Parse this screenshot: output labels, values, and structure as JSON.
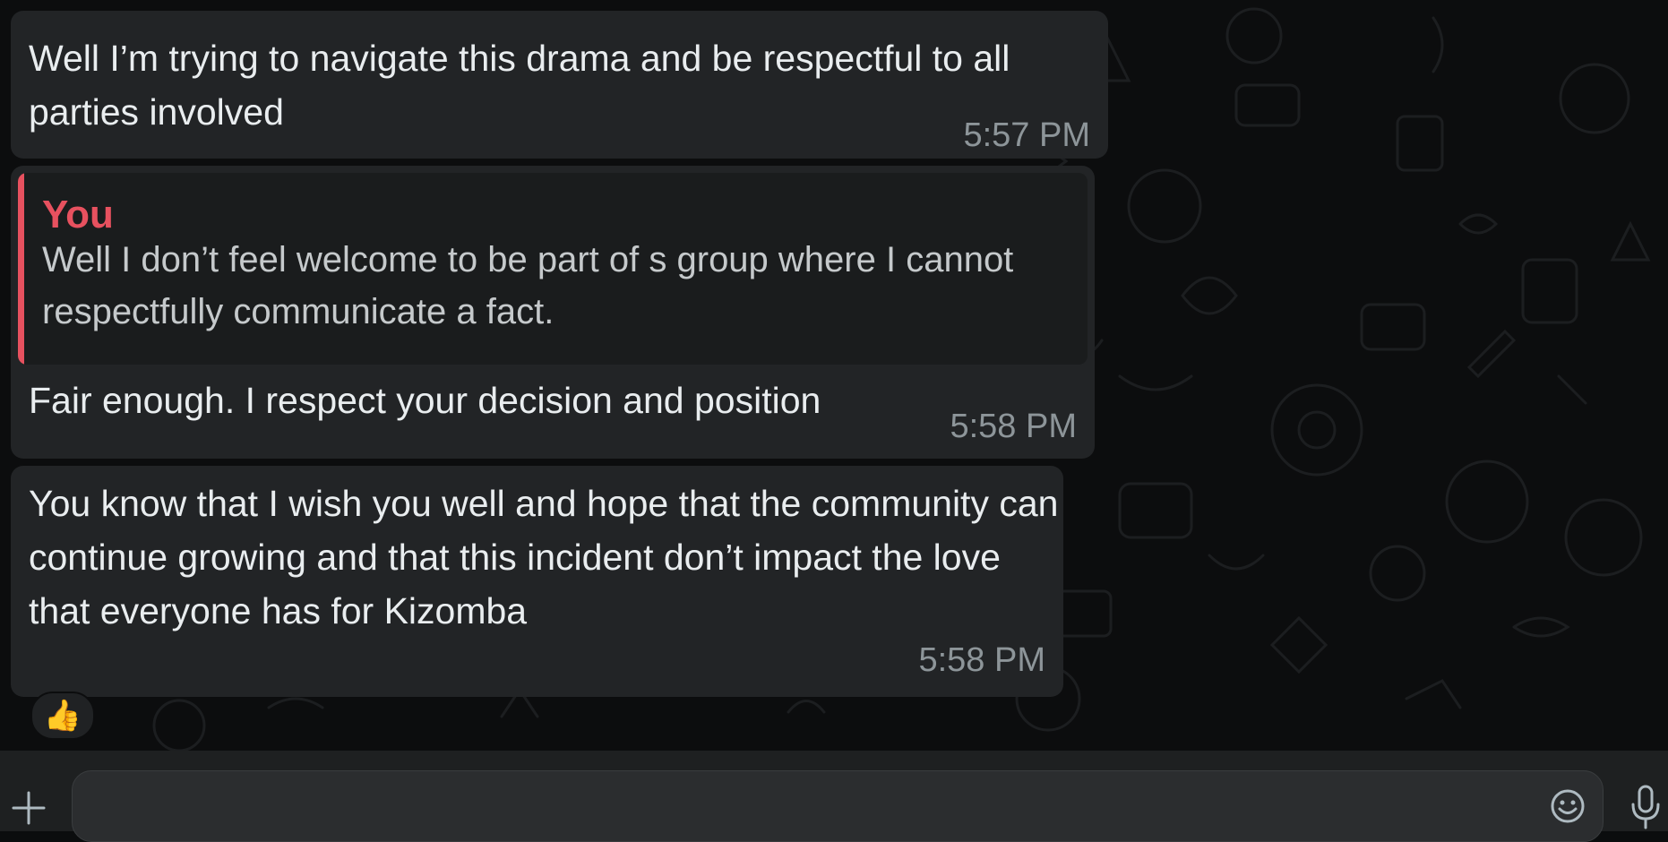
{
  "messages": [
    {
      "text": "Well I’m trying to navigate this drama and be respectful to all parties involved",
      "time": "5:57 PM"
    },
    {
      "quote": {
        "author": "You",
        "text": "Well I don’t feel welcome to be part of s group where I cannot respectfully communicate a fact."
      },
      "text": "Fair enough. I respect your decision and position",
      "time": "5:58 PM"
    },
    {
      "text": "You know that I wish you well and hope that the community can continue growing and that this incident don’t impact the love that everyone has for Kizomba",
      "time": "5:58 PM",
      "reaction": "👍"
    }
  ],
  "composer": {
    "placeholder": "",
    "icons": [
      "plus-icon",
      "emoji-icon",
      "microphone-icon"
    ]
  },
  "colors": {
    "bubble": "#222426",
    "quote_accent": "#e7515f",
    "background": "#0c0d0e",
    "composer": "#1e2021"
  }
}
